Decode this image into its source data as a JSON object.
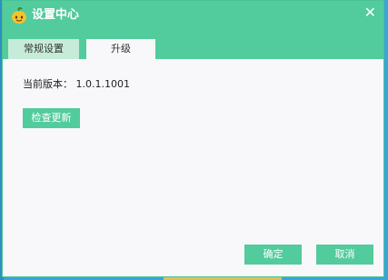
{
  "window": {
    "title": "设置中心",
    "close_glyph": "✕"
  },
  "tabs": [
    {
      "label": "常规设置",
      "selected": false
    },
    {
      "label": "升级",
      "selected": true
    }
  ],
  "upgrade": {
    "version_label": "当前版本：",
    "version_value": "1.0.1.1001",
    "check_button": "检查更新"
  },
  "footer": {
    "ok_label": "确定",
    "cancel_label": "取消"
  },
  "colors": {
    "accent": "#52cb9d",
    "tab_inactive": "#c6ecd9",
    "panel": "#f8f8fa"
  },
  "icons": {
    "logo": "mango-logo-icon",
    "close": "close-icon"
  }
}
